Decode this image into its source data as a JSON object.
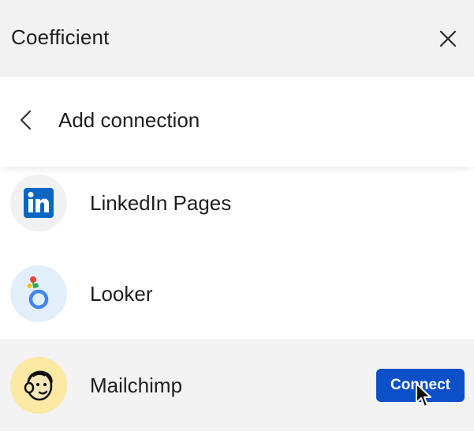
{
  "app": {
    "title": "Coefficient"
  },
  "subheader": {
    "title": "Add connection"
  },
  "connections": [
    {
      "name": "LinkedIn Pages",
      "icon": "linkedin-icon"
    },
    {
      "name": "Looker",
      "icon": "looker-icon"
    },
    {
      "name": "Mailchimp",
      "icon": "mailchimp-icon",
      "action_label": "Connect"
    }
  ],
  "colors": {
    "accent": "#0b4fc9",
    "linkedin": "#0a66c2",
    "looker_bg": "#e3eefb",
    "mailchimp_bg": "#fbe9a4"
  }
}
